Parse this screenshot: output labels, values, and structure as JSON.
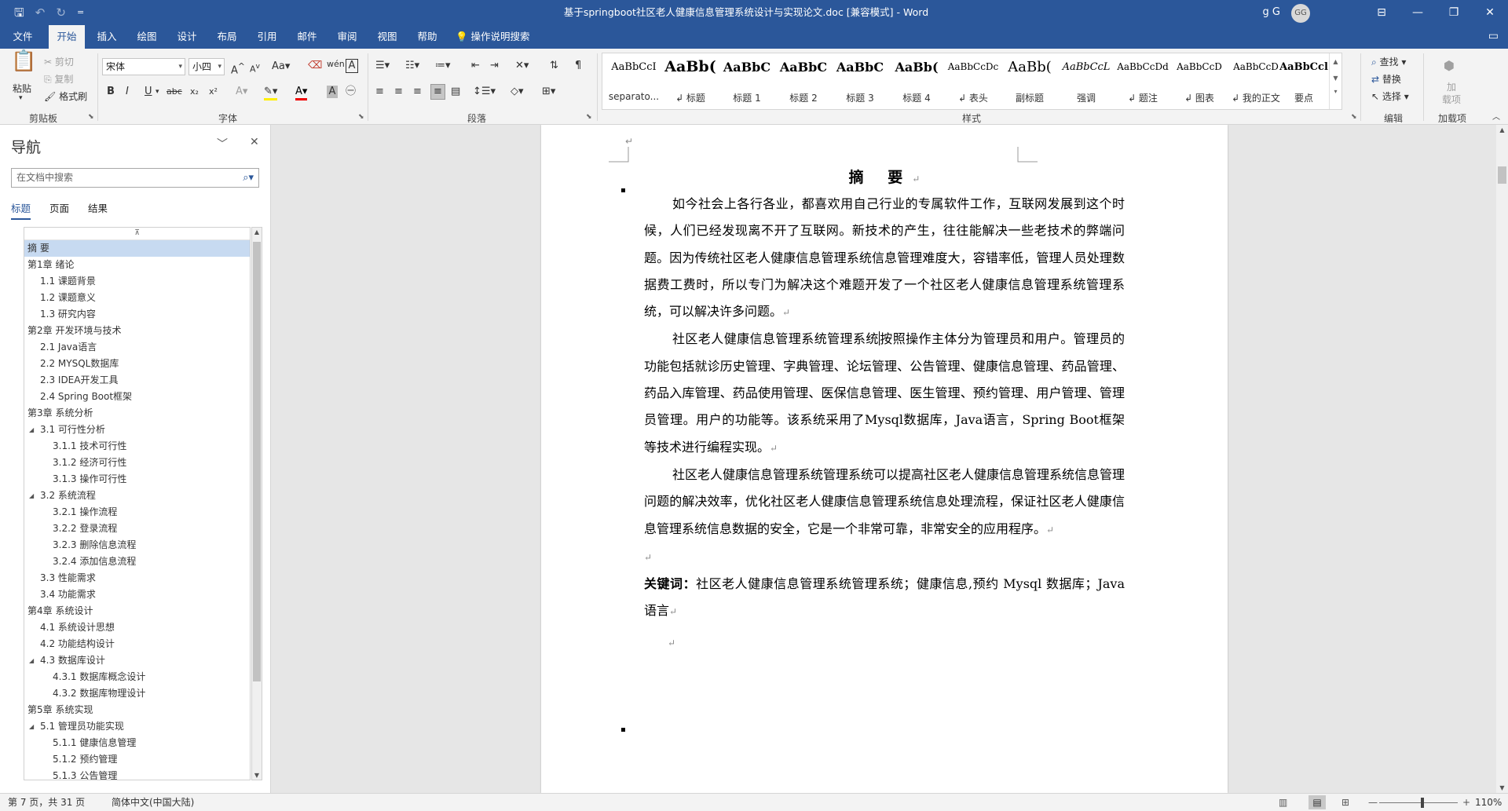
{
  "window": {
    "title": "基于springboot社区老人健康信息管理系统设计与实现论文.doc [兼容模式] - Word",
    "user_name": "g G",
    "avatar_initials": "GG"
  },
  "quick_access": {
    "save": "🖫",
    "undo": "↶",
    "redo": "↻",
    "customize": "="
  },
  "window_controls": {
    "ribbon_display": "⊟",
    "minimize": "—",
    "restore": "❐",
    "close": "✕"
  },
  "tabs": [
    "文件",
    "开始",
    "插入",
    "绘图",
    "设计",
    "布局",
    "引用",
    "邮件",
    "审阅",
    "视图",
    "帮助"
  ],
  "active_tab": "开始",
  "tell_me": "操作说明搜索",
  "ribbon": {
    "clipboard": {
      "paste": "粘贴",
      "cut": "剪切",
      "copy": "复制",
      "format_painter": "格式刷",
      "label": "剪贴板"
    },
    "font": {
      "name": "宋体",
      "size": "小四",
      "case": "Aa",
      "label": "字体",
      "bold": "B",
      "italic": "I",
      "underline": "U",
      "strike": "abc",
      "sub": "x₂",
      "sup": "x²",
      "grow": "A",
      "shrink": "A"
    },
    "paragraph": {
      "label": "段落"
    },
    "styles": {
      "label": "样式",
      "items": [
        {
          "preview": "AaBbCcI",
          "name": "separato..."
        },
        {
          "preview": "AaBb(",
          "name": "↲ 标题"
        },
        {
          "preview": "AaBbC",
          "name": "标题 1"
        },
        {
          "preview": "AaBbC",
          "name": "标题 2"
        },
        {
          "preview": "AaBbC",
          "name": "标题 3"
        },
        {
          "preview": "AaBb(",
          "name": "标题 4"
        },
        {
          "preview": "AaBbCcDc",
          "name": "↲ 表头"
        },
        {
          "preview": "AaBb(",
          "name": "副标题"
        },
        {
          "preview": "AaBbCcL",
          "name": "强调"
        },
        {
          "preview": "AaBbCcDd",
          "name": "↲ 题注"
        },
        {
          "preview": "AaBbCcD",
          "name": "↲ 图表"
        },
        {
          "preview": "AaBbCcD",
          "name": "↲ 我的正文"
        },
        {
          "preview": "AaBbCcl",
          "name": "要点"
        }
      ]
    },
    "editing": {
      "find": "查找",
      "replace": "替换",
      "select": "选择",
      "label": "编辑"
    },
    "addins": {
      "top": "加",
      "bottom": "载项",
      "label": "加载项"
    }
  },
  "nav": {
    "title": "导航",
    "search_placeholder": "在文档中搜索",
    "tabs": [
      "标题",
      "页面",
      "结果"
    ],
    "items": [
      {
        "text": "摘  要",
        "level": 1,
        "selected": true,
        "toggle": ""
      },
      {
        "text": "第1章 绪论",
        "level": 1,
        "toggle": "◢"
      },
      {
        "text": "1.1 课题背景",
        "level": 2,
        "toggle": ""
      },
      {
        "text": "1.2 课题意义",
        "level": 2,
        "toggle": ""
      },
      {
        "text": "1.3 研究内容",
        "level": 2,
        "toggle": ""
      },
      {
        "text": "第2章 开发环境与技术",
        "level": 1,
        "toggle": "◢"
      },
      {
        "text": "2.1 Java语言",
        "level": 2,
        "toggle": ""
      },
      {
        "text": "2.2 MYSQL数据库",
        "level": 2,
        "toggle": ""
      },
      {
        "text": "2.3 IDEA开发工具",
        "level": 2,
        "toggle": ""
      },
      {
        "text": "2.4 Spring Boot框架",
        "level": 2,
        "toggle": ""
      },
      {
        "text": "第3章 系统分析",
        "level": 1,
        "toggle": "◢"
      },
      {
        "text": "3.1 可行性分析",
        "level": 2,
        "toggle": "◢"
      },
      {
        "text": "3.1.1 技术可行性",
        "level": 3,
        "toggle": ""
      },
      {
        "text": "3.1.2 经济可行性",
        "level": 3,
        "toggle": ""
      },
      {
        "text": "3.1.3 操作可行性",
        "level": 3,
        "toggle": ""
      },
      {
        "text": "3.2 系统流程",
        "level": 2,
        "toggle": "◢"
      },
      {
        "text": "3.2.1 操作流程",
        "level": 3,
        "toggle": ""
      },
      {
        "text": "3.2.2 登录流程",
        "level": 3,
        "toggle": ""
      },
      {
        "text": "3.2.3 删除信息流程",
        "level": 3,
        "toggle": ""
      },
      {
        "text": "3.2.4 添加信息流程",
        "level": 3,
        "toggle": ""
      },
      {
        "text": "3.3 性能需求",
        "level": 2,
        "toggle": ""
      },
      {
        "text": "3.4 功能需求",
        "level": 2,
        "toggle": ""
      },
      {
        "text": "第4章 系统设计",
        "level": 1,
        "toggle": "◢"
      },
      {
        "text": "4.1 系统设计思想",
        "level": 2,
        "toggle": ""
      },
      {
        "text": "4.2 功能结构设计",
        "level": 2,
        "toggle": ""
      },
      {
        "text": "4.3 数据库设计",
        "level": 2,
        "toggle": "◢"
      },
      {
        "text": "4.3.1 数据库概念设计",
        "level": 3,
        "toggle": ""
      },
      {
        "text": "4.3.2 数据库物理设计",
        "level": 3,
        "toggle": ""
      },
      {
        "text": "第5章 系统实现",
        "level": 1,
        "toggle": "◢"
      },
      {
        "text": "5.1 管理员功能实现",
        "level": 2,
        "toggle": "◢"
      },
      {
        "text": "5.1.1 健康信息管理",
        "level": 3,
        "toggle": ""
      },
      {
        "text": "5.1.2 预约管理",
        "level": 3,
        "toggle": ""
      },
      {
        "text": "5.1.3 公告管理",
        "level": 3,
        "toggle": ""
      }
    ]
  },
  "document": {
    "heading": "摘  要",
    "para1": "如今社会上各行各业，都喜欢用自己行业的专属软件工作，互联网发展到这个时候，人们已经发现离不开了互联网。新技术的产生，往往能解决一些老技术的弊端问题。因为传统社区老人健康信息管理系统信息管理难度大，容错率低，管理人员处理数据费工费时，所以专门为解决这个难题开发了一个社区老人健康信息管理系统管理系统，可以解决许多问题。",
    "para2_before_cursor": "社区老人健康信息管理系统管理系统",
    "para2_after_cursor": "按照操作主体分为管理员和用户。管理员的功能包括就诊历史管理、字典管理、论坛管理、公告管理、健康信息管理、药品管理、药品入库管理、药品使用管理、医保信息管理、医生管理、预约管理、用户管理、管理员管理。用户的功能等。该系统采用了Mysql数据库，Java语言，Spring Boot框架等技术进行编程实现。",
    "para3": "社区老人健康信息管理系统管理系统可以提高社区老人健康信息管理系统信息管理问题的解决效率，优化社区老人健康信息管理系统信息处理流程，保证社区老人健康信息管理系统信息数据的安全，它是一个非常可靠，非常安全的应用程序。",
    "keywords_label": "关键词：",
    "keywords": "社区老人健康信息管理系统管理系统；健康信息,预约 Mysql 数据库；Java 语言",
    "para_mark": "↵"
  },
  "status": {
    "page": "第 7 页，共 31 页",
    "language": "简体中文(中国大陆)",
    "zoom": "110%",
    "zoom_level": 0.55
  }
}
